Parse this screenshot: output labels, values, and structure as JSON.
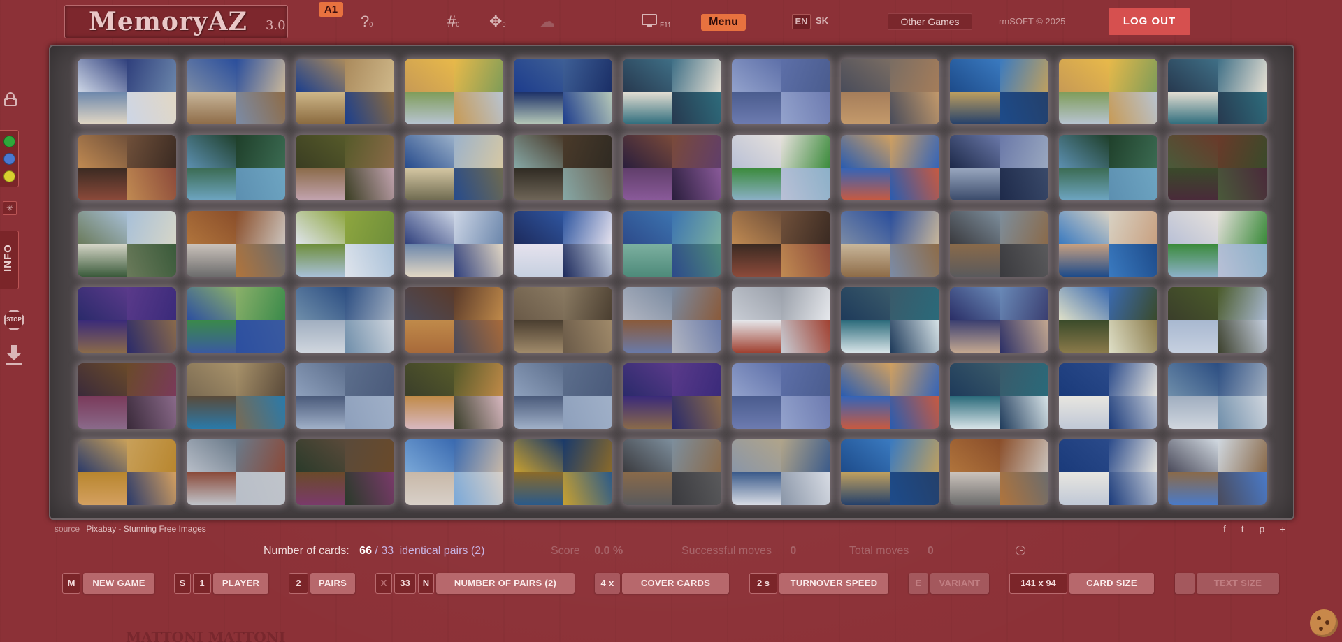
{
  "header": {
    "logo_text": "MemoryAZ",
    "logo_version": "3.0",
    "level_badge": "A1",
    "help_count": "0",
    "hash_count": "0",
    "puzzle_count": "0",
    "fullscreen_key": "F11",
    "menu_label": "Menu",
    "lang_en": "EN",
    "lang_sk": "SK",
    "other_games_label": "Other Games",
    "copyright": "rmSOFT © 2025",
    "logout_label": "LOG OUT"
  },
  "sidebar": {
    "colors": [
      "#2fa83a",
      "#4a78d0",
      "#d8d02e"
    ],
    "info_label": "INFO",
    "stop_label": "STOP"
  },
  "board": {
    "rows": 6,
    "cols": 11,
    "palettes": [
      [
        "#cdd6e6",
        "#2f3f7c",
        "#6b86ab",
        "#e2d7c4"
      ],
      [
        "#7b8ba6",
        "#2a4e9c",
        "#c9b79b",
        "#8e6c48"
      ],
      [
        "#1c3f8d",
        "#aa8a5c",
        "#cfb88a",
        "#8a6a3f"
      ],
      [
        "#c79a55",
        "#e8b94a",
        "#7e9c58",
        "#b8c4d2"
      ],
      [
        "#1d3c8c",
        "#3e5f96",
        "#1a2e66",
        "#b7c9b8"
      ],
      [
        "#27394f",
        "#3f6f86",
        "#e6e0d4",
        "#2e6c7c"
      ],
      [
        "#93a2cc",
        "#5d6fa8",
        "#4a5c8e",
        "#6d7bb0"
      ],
      [
        "#494c5a",
        "#7a6d63",
        "#a57d5a",
        "#c49a6b"
      ],
      [
        "#1d4b8a",
        "#3a7ac0",
        "#bfa05f",
        "#24406b"
      ],
      [
        "#c79a55",
        "#e8b94a",
        "#7e9c58",
        "#b8c4d2"
      ],
      [
        "#27394f",
        "#3f6f86",
        "#e6e0d4",
        "#2e6c7c"
      ],
      [
        "#c08a52",
        "#70503a",
        "#3a2a22",
        "#8c4a3a"
      ],
      [
        "#5c8fb0",
        "#1f3f2a",
        "#3b6b52",
        "#6ea5c2"
      ],
      [
        "#3a3d22",
        "#565a2a",
        "#8a6a48",
        "#c3a4b0"
      ],
      [
        "#274b8c",
        "#9cb2ca",
        "#d6c8a4",
        "#6e6a50"
      ],
      [
        "#86a8a6",
        "#4a3a2a",
        "#2f2a22",
        "#6f6658"
      ],
      [
        "#2a1e3c",
        "#7a4a3a",
        "#603e6a",
        "#8a5a9a"
      ],
      [
        "#b9c0d6",
        "#e6e1dc",
        "#3a8a3a",
        "#8cb0c8"
      ],
      [
        "#2a5cb0",
        "#d0a060",
        "#3464b8",
        "#c85a40"
      ],
      [
        "#1e2a4a",
        "#6a78a8",
        "#9aa8c0",
        "#3a4a6a"
      ],
      [
        "#5c8fb0",
        "#1f3f2a",
        "#3b6b52",
        "#6ea5c2"
      ],
      [
        "#4a5a3a",
        "#6a3a2a",
        "#3a4a2a",
        "#4a2a3a"
      ],
      [
        "#6a7a5a",
        "#a8c0d8",
        "#d6d6c8",
        "#3a5a3a"
      ],
      [
        "#b0743c",
        "#8a4e2a",
        "#cbc3bc",
        "#6c6c6c"
      ],
      [
        "#dfe4ec",
        "#8ea63f",
        "#6e8e3a",
        "#a8c0d8"
      ],
      [
        "#2f3f7c",
        "#cdd6e6",
        "#6b86ab",
        "#e2d7c4"
      ],
      [
        "#1d2a5c",
        "#2f56a0",
        "#e6e2ee",
        "#c6d0e0"
      ],
      [
        "#2d4a8a",
        "#3c74b0",
        "#7cb0a0",
        "#4e8a7a"
      ],
      [
        "#c08a52",
        "#70503a",
        "#3a2a22",
        "#8c4a3a"
      ],
      [
        "#7b8ba6",
        "#2a4e9c",
        "#c9b79b",
        "#8e6c48"
      ],
      [
        "#3a3a3e",
        "#7d8e9c",
        "#8a6a4a",
        "#5a5a5c"
      ],
      [
        "#3a7ac0",
        "#d8d2c4",
        "#c8a080",
        "#1d4b8a"
      ],
      [
        "#b9c0d6",
        "#e6e1dc",
        "#3a8a3a",
        "#8cb0c8"
      ],
      [
        "#2a2a6a",
        "#5a3a8a",
        "#3a2a7a",
        "#8a6a4a"
      ],
      [
        "#2c4fa0",
        "#8bb06a",
        "#3a8a4a",
        "#3a5aa0"
      ],
      [
        "#6f8eaa",
        "#2c4e82",
        "#a0aec0",
        "#d0d6de"
      ],
      [
        "#4a4a5a",
        "#5a3a2a",
        "#c08a4a",
        "#a86a3a"
      ],
      [
        "#6a5a48",
        "#8a7a62",
        "#4a3e30",
        "#a08a6a"
      ],
      [
        "#b2b6c2",
        "#7a8aa0",
        "#8a5a3a",
        "#6a7aa8"
      ],
      [
        "#c8ccd4",
        "#9aa0aa",
        "#e6e8ec",
        "#a04030"
      ],
      [
        "#1e3a5a",
        "#3a5a6a",
        "#2a6a7a",
        "#d8e4e8"
      ],
      [
        "#2a2e66",
        "#6a8ab8",
        "#3a3e70",
        "#c4a890"
      ],
      [
        "#dfe0c8",
        "#3a6ab0",
        "#3a4a2a",
        "#8a7a4a"
      ],
      [
        "#3a3e2a",
        "#4a5a2a",
        "#a8b8d0",
        "#c6d0e0"
      ],
      [
        "#3a2a3a",
        "#6a4a2a",
        "#7a3a5a",
        "#8a6a8a"
      ],
      [
        "#7a6a52",
        "#a8926a",
        "#5a4a3a",
        "#2a7aaa"
      ],
      [
        "#8ea0bc",
        "#5c6e8c",
        "#4a5a7a",
        "#a0b0c8"
      ],
      [
        "#3a3e2a",
        "#565a2a",
        "#c08a48",
        "#d8b8c0"
      ],
      [
        "#8ea0bc",
        "#5c6e8c",
        "#4a5a7a",
        "#a0b0c8"
      ],
      [
        "#2a2a6a",
        "#5a3a8a",
        "#3a2a7a",
        "#8a6a4a"
      ],
      [
        "#93a2cc",
        "#5d6fa8",
        "#4a5c8e",
        "#6d7bb0"
      ],
      [
        "#2a5cb0",
        "#d0a060",
        "#3464b8",
        "#c85a40"
      ],
      [
        "#1e3a5a",
        "#3a5a6a",
        "#2a6a7a",
        "#d8e4e8"
      ],
      [
        "#1a3a7a",
        "#2a4a8a",
        "#e8e6e0",
        "#c0c8d6"
      ],
      [
        "#6f8eaa",
        "#2c4e82",
        "#a0aec0",
        "#d0d6de"
      ],
      [
        "#2a3a6a",
        "#c8a05a",
        "#b8862e",
        "#d4a060"
      ],
      [
        "#b8bec8",
        "#6a7a8a",
        "#8a4a3a",
        "#c0c4ca"
      ],
      [
        "#2a3a2a",
        "#5a4a3a",
        "#6a4a2a",
        "#7a3a6a"
      ],
      [
        "#7aa8d8",
        "#3a6ab0",
        "#c8b8a8",
        "#d8d0c8"
      ],
      [
        "#c8a030",
        "#1a3a6a",
        "#8a6a2a",
        "#2a5a8a"
      ],
      [
        "#3a3a3e",
        "#7d8e9c",
        "#8a6a4a",
        "#5a5a5c"
      ],
      [
        "#8a96a8",
        "#b0a48a",
        "#3a5a8a",
        "#d8dce4"
      ],
      [
        "#1d4b8a",
        "#3a7ac0",
        "#bfa05f",
        "#24406b"
      ],
      [
        "#b0743c",
        "#8a4e2a",
        "#cbc3bc",
        "#6c6c6c"
      ],
      [
        "#1a3a7a",
        "#2a4a8a",
        "#e8e6e0",
        "#c0c8d6"
      ],
      [
        "#4a4a5a",
        "#d0d8e0",
        "#8a6a4a",
        "#4a7ac8"
      ]
    ]
  },
  "footer": {
    "source_label": "source",
    "source_link": "Pixabay - Stunning Free Images",
    "share_icons": "f  t  p  +",
    "stats": {
      "cards_label": "Number of cards:",
      "cards_value": "66",
      "separator": "/",
      "pairs_value": "33",
      "pairs_text": "identical pairs (2)",
      "score_label": "Score",
      "score_value": "0.0 %",
      "successful_label": "Successful moves",
      "successful_value": "0",
      "total_label": "Total moves",
      "total_value": "0"
    },
    "controls": {
      "new_game_key": "M",
      "new_game_label": "NEW GAME",
      "player_key": "S",
      "player_value": "1",
      "player_label": "PLAYER",
      "pairs_value": "2",
      "pairs_label": "PAIRS",
      "numpairs_key_x": "X",
      "numpairs_value": "33",
      "numpairs_key_n": "N",
      "numpairs_label": "NUMBER OF PAIRS (2)",
      "cover_value": "4 x",
      "cover_label": "COVER CARDS",
      "speed_value": "2 s",
      "speed_label": "TURNOVER SPEED",
      "variant_key": "E",
      "variant_label": "VARIANT",
      "size_value": "141 x 94",
      "size_label": "CARD SIZE",
      "text_size_label": "TEXT SIZE"
    },
    "watermark": "MATTONI     MATTONI"
  }
}
